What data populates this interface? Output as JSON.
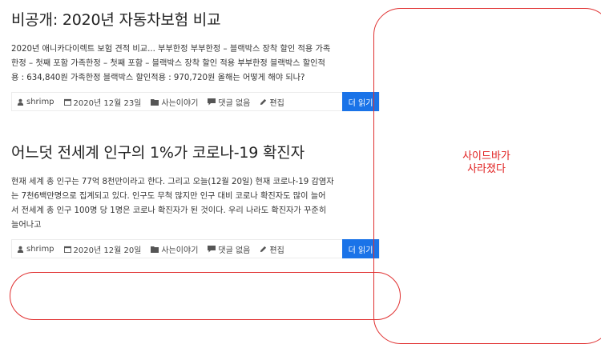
{
  "posts": [
    {
      "title": "비공개: 2020년 자동차보험 비교",
      "excerpt_lines": [
        "2020년 애니카다이렉트 보험 견적 비교... 부부한정 부부한정 – 블랙박스 장착 할인 적용 가족",
        "한정 – 첫째 포함 가족한정 – 첫째 포함 – 블랙박스 장착 할인 적용 부부한정 블랙박스 할인적",
        "용 : 634,840원 가족한정 블랙박스 할인적용 : 970,720원 올해는 어떻게 해야 되나?"
      ],
      "meta": {
        "author": "shrimp",
        "date": "2020년 12월 23일",
        "category": "사는이야기",
        "comments": "댓글 없음",
        "edit": "편집"
      },
      "read_more": "더 읽기"
    },
    {
      "title": "어느덧 전세계 인구의 1%가 코로나-19 확진자",
      "excerpt_lines": [
        "현재 세계 총 인구는 77억 8천만이라고 한다. 그리고 오늘(12월 20일) 현재 코로나-19 감염자",
        "는 7천6백만명으로 집계되고 있다. 인구도 무척 많지만 인구 대비 코로나 확진자도 많이 늘어",
        "서 전세계 총 인구 100명 당 1명은 코로나 확진자가 된 것이다. 우리 나라도 확진자가 꾸준히",
        "늘어나고"
      ],
      "meta": {
        "author": "shrimp",
        "date": "2020년 12월 20일",
        "category": "사는이야기",
        "comments": "댓글 없음",
        "edit": "편집"
      },
      "read_more": "더 읽기"
    }
  ],
  "sidebar": {
    "message_line1": "사이드바가",
    "message_line2": "사라졌다"
  },
  "icons": [
    "user-icon",
    "calendar-icon",
    "folder-icon",
    "comment-icon",
    "pencil-icon"
  ],
  "colors": {
    "accent": "#1a73e8",
    "annotation": "#e03030"
  }
}
